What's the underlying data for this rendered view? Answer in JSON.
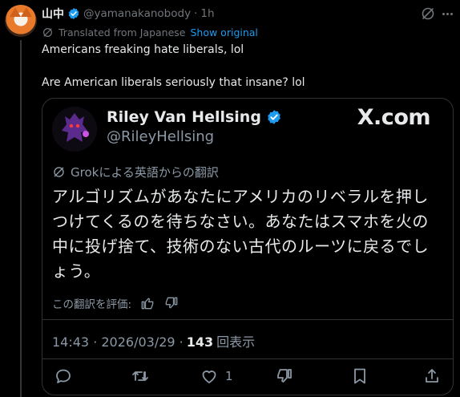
{
  "post": {
    "author_name": "山中",
    "handle": "@yamanakanobody",
    "separator": "·",
    "time": "1h",
    "translated_label": "Translated from Japanese",
    "show_original": "Show original",
    "line1": "Americans freaking hate liberals, lol",
    "line2": "Are American liberals seriously that insane? lol"
  },
  "quote": {
    "name": "Riley Van Hellsing",
    "handle": "@RileyHellsing",
    "site_logo": "X.com",
    "grok_label": "Grokによる英語からの翻訳",
    "body": "アルゴリズムがあなたにアメリカのリベラルを押しつけてくるのを待ちなさい。あなたはスマホを火の中に投げ捨て、技術のない古代のルーツに戻るでしょう。",
    "rate_label": "この翻訳を評価:",
    "timestamp": "14:43 · 2026/03/29 ·",
    "views_count": "143",
    "views_label": "回表示",
    "like_count": "1"
  },
  "icons": {
    "verified": "verified-badge-icon",
    "grok": "grok-icon",
    "more": "more-icon",
    "reply": "reply-icon",
    "retweet": "retweet-icon",
    "like": "like-icon",
    "dislike": "thumbs-down-icon",
    "bookmark": "bookmark-icon",
    "share": "share-icon"
  },
  "colors": {
    "background": "#000000",
    "text": "#e7e9ea",
    "muted": "#71767b",
    "link": "#1d9bf0",
    "verified": "#1d9bf0",
    "border": "#2f3336"
  }
}
